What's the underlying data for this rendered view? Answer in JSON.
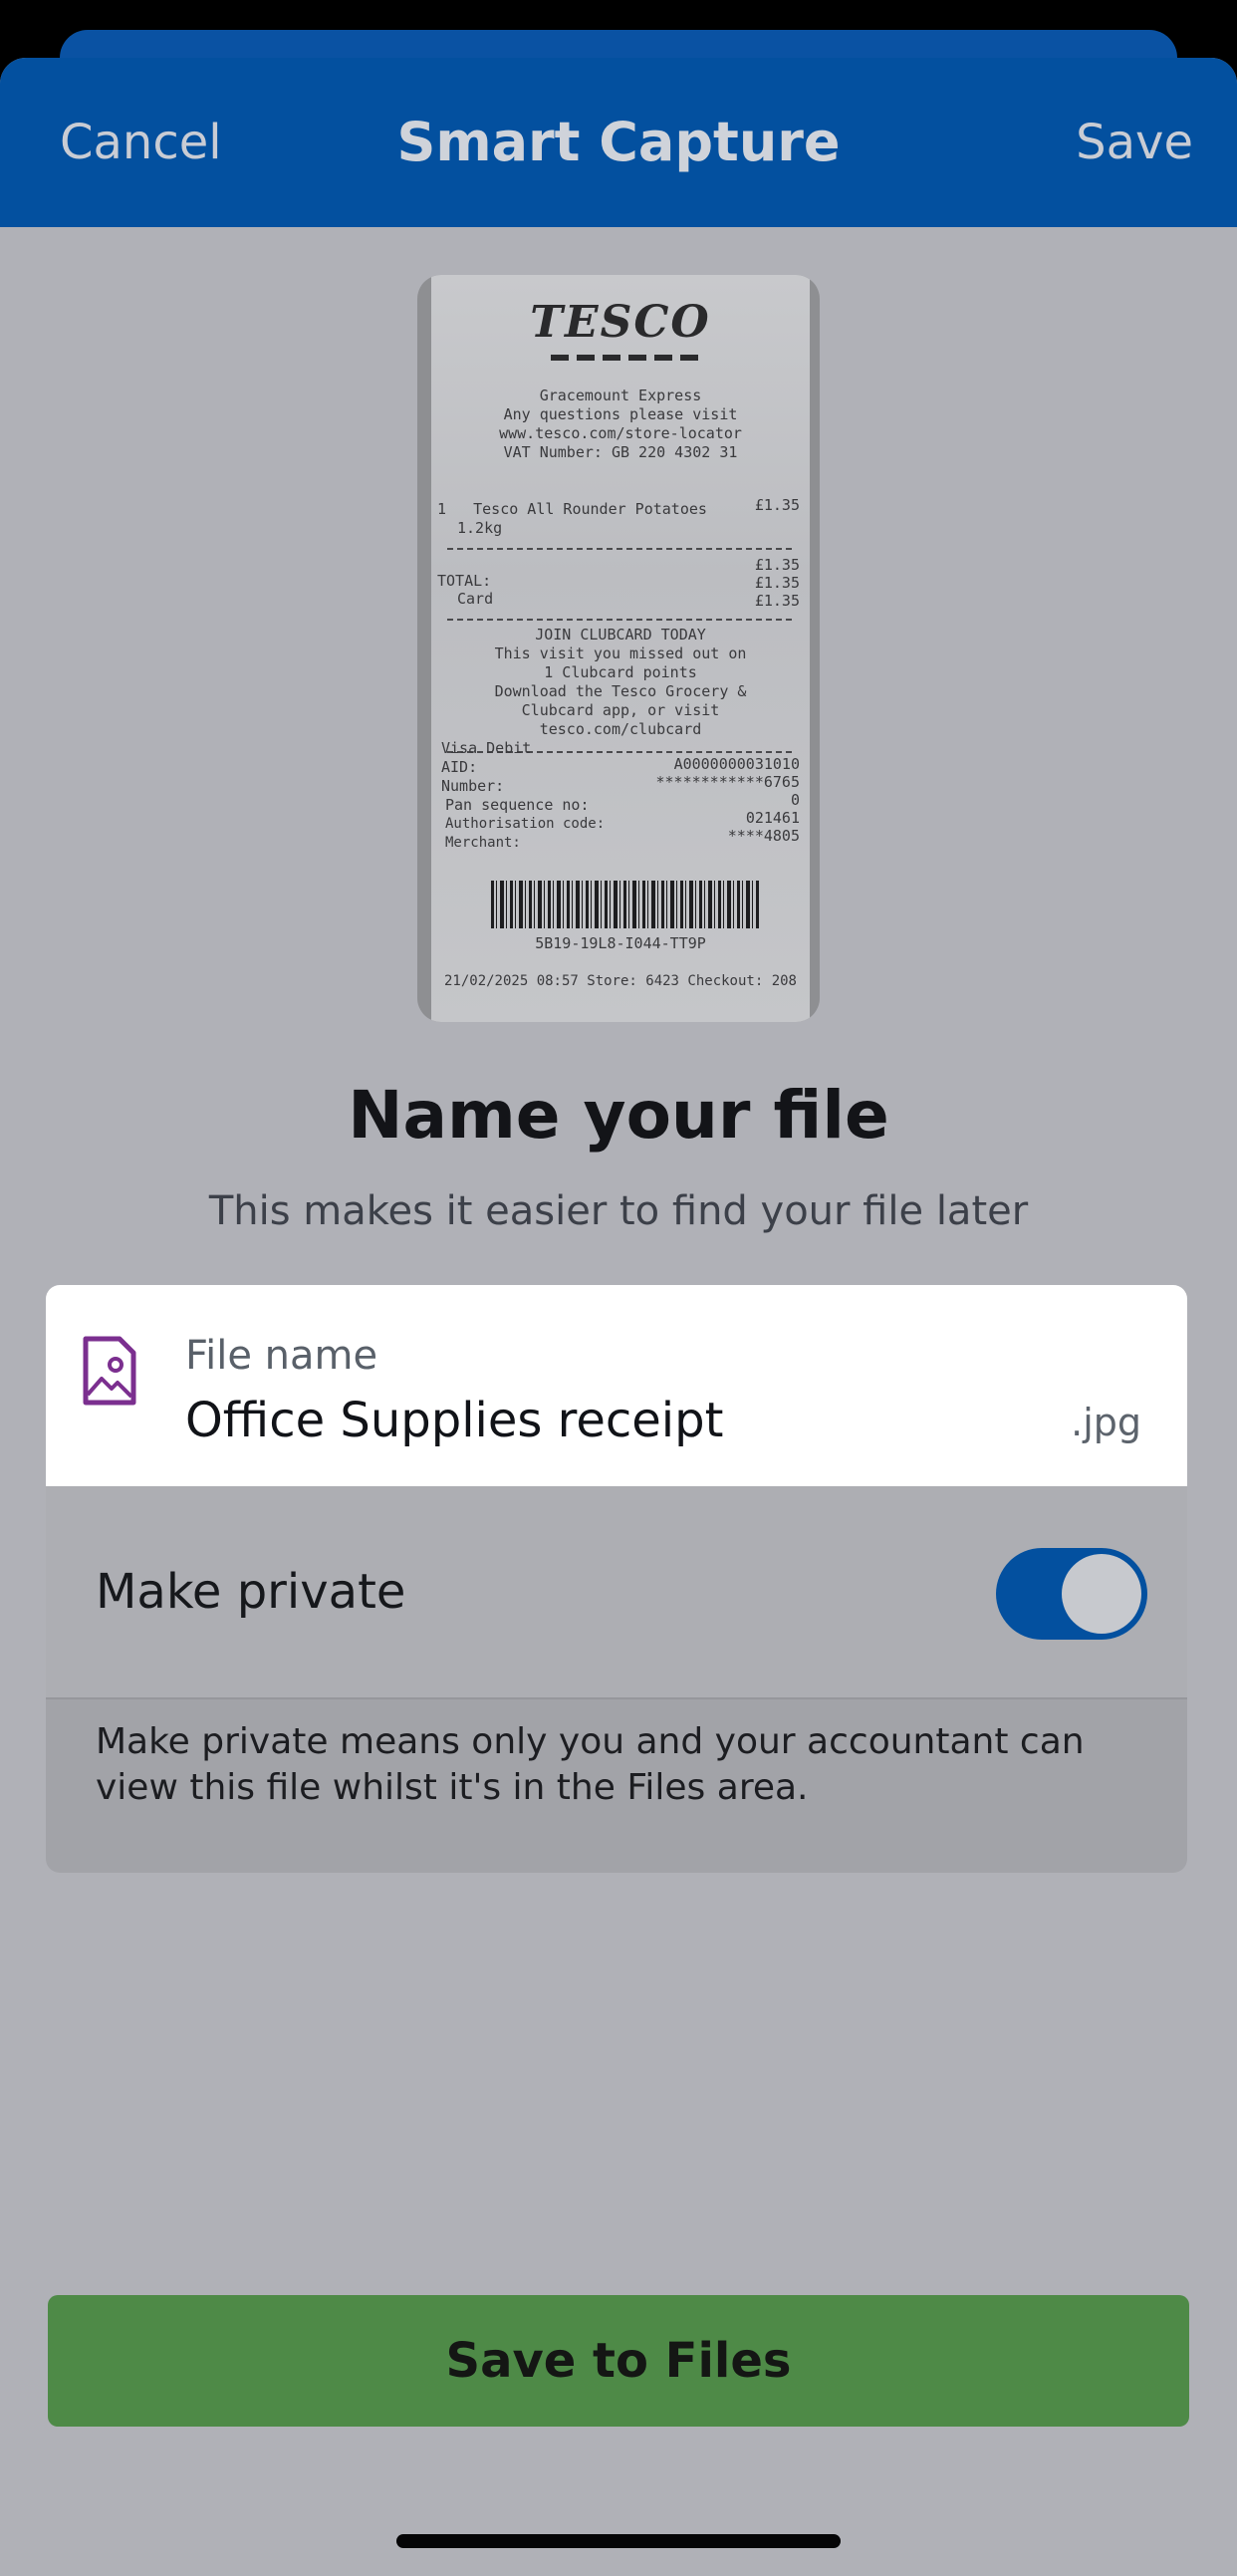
{
  "navbar": {
    "cancel_label": "Cancel",
    "title": "Smart Capture",
    "save_label": "Save"
  },
  "receipt_preview": {
    "store": "TESCO",
    "header_lines": [
      "Gracemount Express",
      "Any questions please visit",
      "www.tesco.com/store-locator",
      "VAT Number: GB 220 4302 31"
    ],
    "item": "1   Tesco All Rounder Potatoes",
    "item_price": "£1.35",
    "item_qty": "1.2kg",
    "subtotal": "£1.35",
    "total_label": "TOTAL:",
    "total": "£1.35",
    "card_label": "Card",
    "card": "£1.35",
    "clubcard_lines": [
      "JOIN CLUBCARD TODAY",
      "This visit you missed out on",
      "1 Clubcard points",
      "Download the Tesco Grocery &",
      "Clubcard app, or visit",
      "tesco.com/clubcard"
    ],
    "payment_lines": [
      {
        "label": "Visa Debit",
        "value": ""
      },
      {
        "label": "AID:",
        "value": "A0000000031010"
      },
      {
        "label": "Number:",
        "value": "************6765"
      },
      {
        "label": "Pan sequence no:",
        "value": "0"
      },
      {
        "label": "Authorisation code:",
        "value": "021461"
      },
      {
        "label": "Merchant:",
        "value": "****4805"
      }
    ],
    "barcode_text": "5B19-19L8-I044-TT9P",
    "footer": "21/02/2025 08:57 Store: 6423 Checkout: 208"
  },
  "main": {
    "title": "Name your file",
    "subtitle": "This makes it easier to find your file later"
  },
  "file_card": {
    "icon": "image-file-icon",
    "icon_color": "#7b2f8f",
    "label": "File name",
    "value": "Office Supplies receipt",
    "extension": ".jpg"
  },
  "privacy": {
    "label": "Make private",
    "toggle_on": true,
    "note": "Make private means only you and your accountant can view this file whilst it's in the Files area."
  },
  "footer_button": {
    "label": "Save to Files",
    "color": "#4e8a47"
  },
  "colors": {
    "nav_blue": "#03509f",
    "overlay_gray": "#b0b1b7"
  }
}
